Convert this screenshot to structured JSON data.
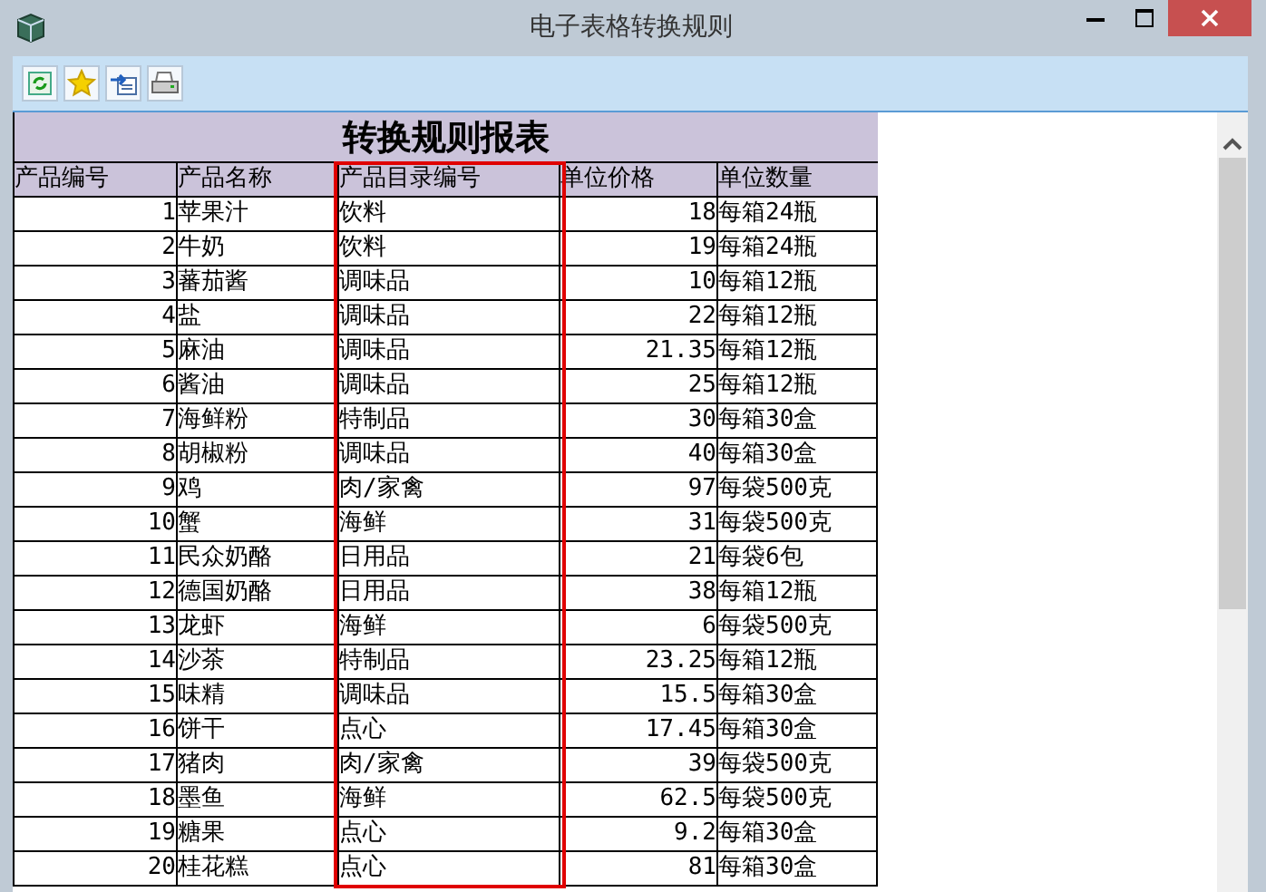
{
  "window": {
    "title": "电子表格转换规则"
  },
  "toolbar": {
    "buttons": [
      {
        "kind": "refresh"
      },
      {
        "kind": "star"
      },
      {
        "kind": "export"
      },
      {
        "kind": "print"
      }
    ]
  },
  "report": {
    "title": "转换规则报表",
    "columns": [
      {
        "label": "产品编号",
        "kind": "number",
        "highlighted": false
      },
      {
        "label": "产品名称",
        "kind": "text",
        "highlighted": false
      },
      {
        "label": "产品目录编号",
        "kind": "text",
        "highlighted": true
      },
      {
        "label": "单位价格",
        "kind": "number",
        "highlighted": false
      },
      {
        "label": "单位数量",
        "kind": "text",
        "highlighted": false
      }
    ],
    "rows": [
      [
        "1",
        "苹果汁",
        "饮料",
        "18",
        "每箱24瓶"
      ],
      [
        "2",
        "牛奶",
        "饮料",
        "19",
        "每箱24瓶"
      ],
      [
        "3",
        "蕃茄酱",
        "调味品",
        "10",
        "每箱12瓶"
      ],
      [
        "4",
        "盐",
        "调味品",
        "22",
        "每箱12瓶"
      ],
      [
        "5",
        "麻油",
        "调味品",
        "21.35",
        "每箱12瓶"
      ],
      [
        "6",
        "酱油",
        "调味品",
        "25",
        "每箱12瓶"
      ],
      [
        "7",
        "海鲜粉",
        "特制品",
        "30",
        "每箱30盒"
      ],
      [
        "8",
        "胡椒粉",
        "调味品",
        "40",
        "每箱30盒"
      ],
      [
        "9",
        "鸡",
        "肉/家禽",
        "97",
        "每袋500克"
      ],
      [
        "10",
        "蟹",
        "海鲜",
        "31",
        "每袋500克"
      ],
      [
        "11",
        "民众奶酪",
        "日用品",
        "21",
        "每袋6包"
      ],
      [
        "12",
        "德国奶酪",
        "日用品",
        "38",
        "每箱12瓶"
      ],
      [
        "13",
        "龙虾",
        "海鲜",
        "6",
        "每袋500克"
      ],
      [
        "14",
        "沙茶",
        "特制品",
        "23.25",
        "每箱12瓶"
      ],
      [
        "15",
        "味精",
        "调味品",
        "15.5",
        "每箱30盒"
      ],
      [
        "16",
        "饼干",
        "点心",
        "17.45",
        "每箱30盒"
      ],
      [
        "17",
        "猪肉",
        "肉/家禽",
        "39",
        "每袋500克"
      ],
      [
        "18",
        "墨鱼",
        "海鲜",
        "62.5",
        "每袋500克"
      ],
      [
        "19",
        "糖果",
        "点心",
        "9.2",
        "每箱30盒"
      ],
      [
        "20",
        "桂花糕",
        "点心",
        "81",
        "每箱30盒"
      ]
    ]
  }
}
